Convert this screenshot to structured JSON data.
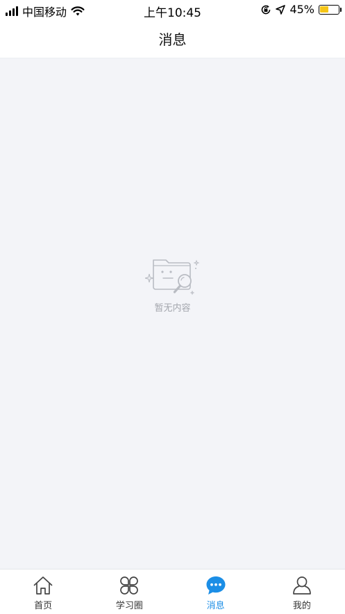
{
  "status_bar": {
    "carrier": "中国移动",
    "time": "上午10:45",
    "battery_percent": "45%",
    "battery_level": 0.45
  },
  "nav": {
    "title": "消息"
  },
  "empty_state": {
    "text": "暂无内容",
    "icon": "empty-folder-search-icon"
  },
  "tabs": [
    {
      "label": "首页",
      "icon": "home-icon",
      "active": false
    },
    {
      "label": "学习圈",
      "icon": "clover-icon",
      "active": false
    },
    {
      "label": "消息",
      "icon": "chat-bubble-icon",
      "active": true
    },
    {
      "label": "我的",
      "icon": "user-icon",
      "active": false
    }
  ],
  "colors": {
    "accent": "#1b8ee6",
    "content_bg": "#f3f4f8",
    "battery": "#f5c518",
    "empty_text": "#a3a6ad"
  }
}
